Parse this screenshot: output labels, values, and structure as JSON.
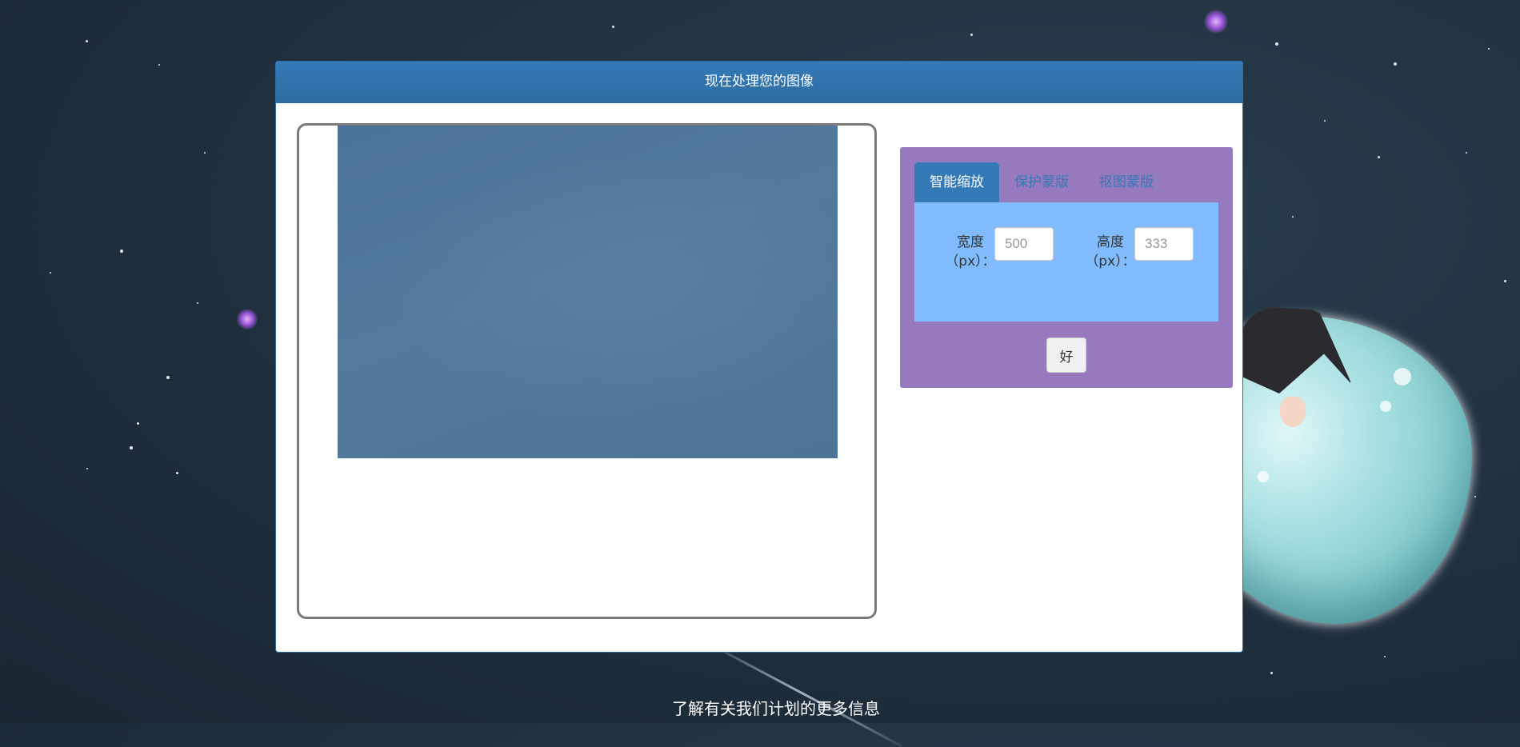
{
  "panel": {
    "title": "现在处理您的图像"
  },
  "settings": {
    "tabs": [
      {
        "label": "智能缩放",
        "active": true
      },
      {
        "label": "保护蒙版",
        "active": false
      },
      {
        "label": "抠图蒙版",
        "active": false
      }
    ],
    "width_field": {
      "label": "宽度（px）：",
      "placeholder": "500",
      "value": ""
    },
    "height_field": {
      "label": "高度（px）：",
      "placeholder": "333",
      "value": ""
    },
    "ok_label": "好"
  },
  "footer": {
    "link_text": "了解有关我们计划的更多信息"
  },
  "colors": {
    "header_blue": "#337ab7",
    "settings_purple": "#9779bd",
    "tab_body_blue": "#80bcfd",
    "background": "#1f2f3d"
  }
}
